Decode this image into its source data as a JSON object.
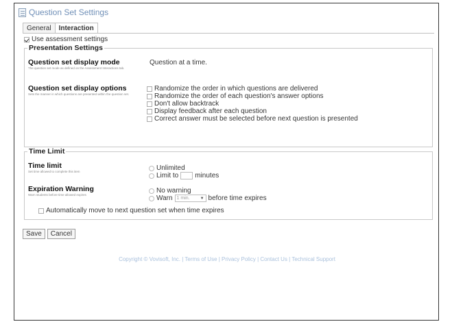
{
  "page": {
    "title": "Question Set Settings"
  },
  "tabs": [
    {
      "label": "General",
      "active": false
    },
    {
      "label": "Interaction",
      "active": true
    }
  ],
  "use_assessment_settings": {
    "label": "Use assessment settings",
    "checked": true
  },
  "presentation": {
    "legend": "Presentation Settings",
    "display_mode": {
      "label": "Question set display mode",
      "description": "The question set mode as defined on the Assessment Interactions tab.",
      "value": "Question at a time."
    },
    "display_options": {
      "label": "Question set display options",
      "description": "Sets the manner in which questions are presented within the question set.",
      "options": [
        {
          "label": "Randomize the order in which questions are delivered",
          "checked": false
        },
        {
          "label": "Randomize the order of each question's answer options",
          "checked": false
        },
        {
          "label": "Don't allow backtrack",
          "checked": false
        },
        {
          "label": "Display feedback after each question",
          "checked": false
        },
        {
          "label": "Correct answer must be selected before next question is presented",
          "checked": false
        }
      ]
    }
  },
  "time_limit": {
    "legend": "Time Limit",
    "limit": {
      "label": "Time limit",
      "description": "Set time allowed to complete this item",
      "unlimited_label": "Unlimited",
      "limit_to_label": "Limit to",
      "minutes_label": "minutes",
      "minutes_value": ""
    },
    "warning": {
      "label": "Expiration Warning",
      "description": "Warn students before time allowed expires",
      "no_warning_label": "No warning",
      "warn_label": "Warn",
      "warn_select_value": "1 min.",
      "before_label": "before time expires"
    },
    "auto_move": {
      "label": "Automatically move to next question set when time expires",
      "checked": false
    }
  },
  "buttons": {
    "save": "Save",
    "cancel": "Cancel"
  },
  "footer": {
    "links": [
      "Copyright © Vovisoft, Inc.",
      "Terms of Use",
      "Privacy Policy",
      "Contact Us",
      "Technical Support"
    ],
    "separator": " | "
  }
}
